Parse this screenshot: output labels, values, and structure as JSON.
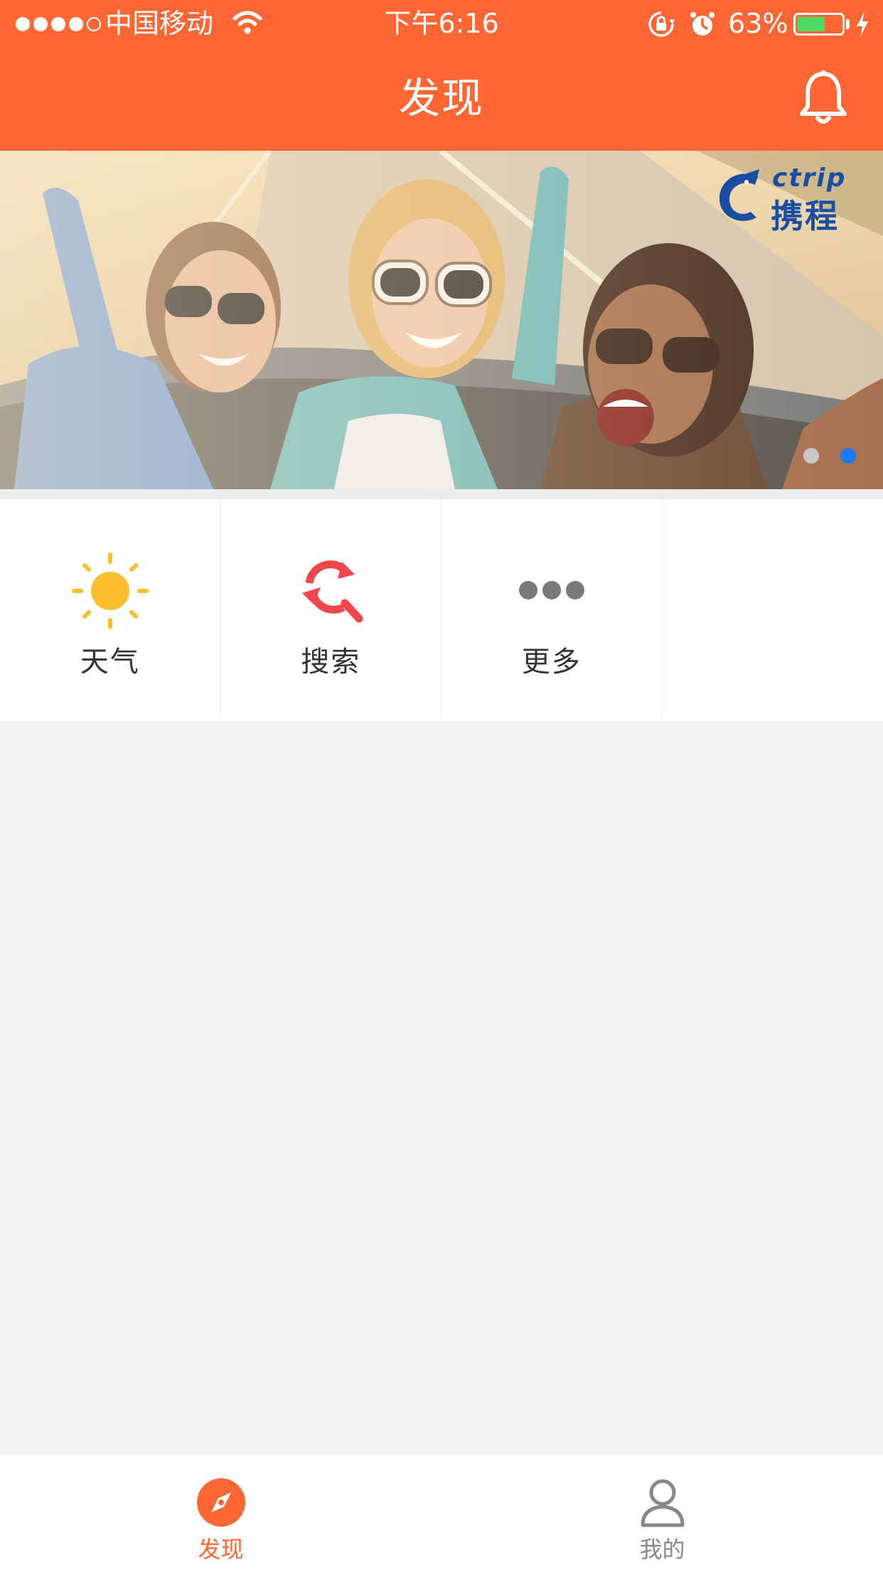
{
  "status_bar": {
    "carrier": "中国移动",
    "time": "下午6:16",
    "battery_percent": "63%",
    "battery_level": 0.63,
    "icons": [
      "signal-dots",
      "wifi-icon",
      "rotation-lock-icon",
      "alarm-icon",
      "battery-icon",
      "charging-icon"
    ]
  },
  "nav": {
    "title": "发现",
    "right_icon": "bell-icon"
  },
  "banner": {
    "brand_en": "ctrip",
    "brand_cn": "携程",
    "page_count": 2,
    "active_page": 2
  },
  "features": [
    {
      "label": "天气",
      "icon": "sun-icon",
      "color": "#fbbf2d"
    },
    {
      "label": "搜索",
      "icon": "search-refresh-icon",
      "color": "#f0474b"
    },
    {
      "label": "更多",
      "icon": "more-dots-icon",
      "color": "#7a7a7a"
    },
    {
      "label": "",
      "icon": "",
      "color": ""
    }
  ],
  "tabbar": {
    "tabs": [
      {
        "label": "发现",
        "icon": "compass-icon",
        "active": true
      },
      {
        "label": "我的",
        "icon": "user-icon",
        "active": false
      }
    ]
  },
  "colors": {
    "brand_orange": "#fe6634",
    "active_blue": "#1a7af8",
    "background": "#f3f3f3"
  }
}
